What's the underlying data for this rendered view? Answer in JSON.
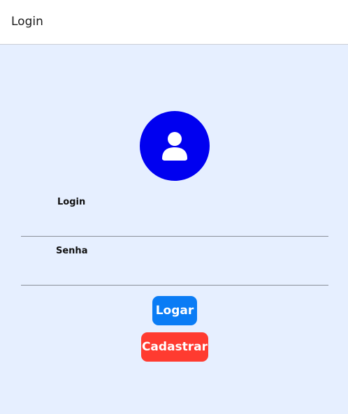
{
  "header": {
    "title": "Login"
  },
  "avatar": {
    "icon": "user-icon",
    "background_color": "#0000f0"
  },
  "form": {
    "login": {
      "label": "Login",
      "value": "",
      "placeholder": ""
    },
    "senha": {
      "label": "Senha",
      "value": "",
      "placeholder": ""
    }
  },
  "buttons": {
    "logar_label": "Logar",
    "logar_color": "#0a7cf5",
    "cadastrar_label": "Cadastrar",
    "cadastrar_color": "#ff3b30"
  },
  "colors": {
    "page_background": "#e6efff",
    "header_background": "#ffffff"
  }
}
